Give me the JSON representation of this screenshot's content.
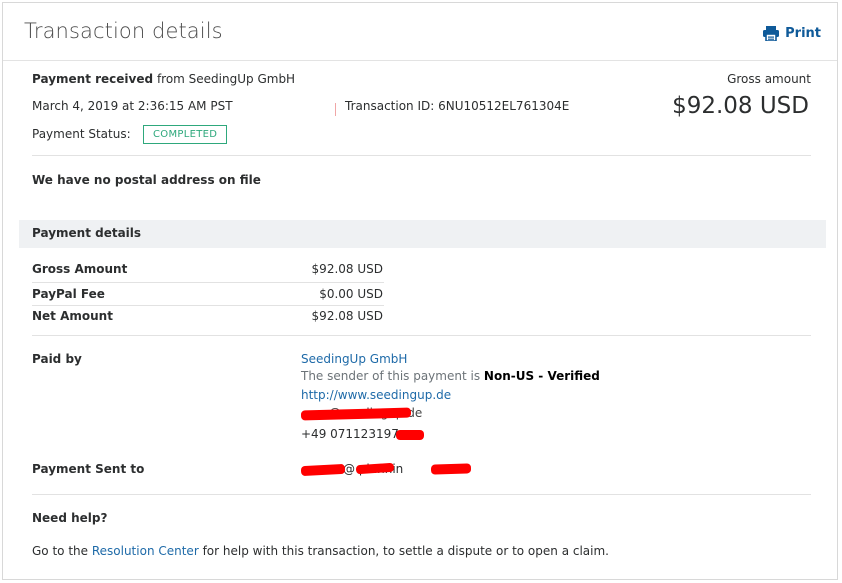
{
  "header": {
    "title": "Transaction details",
    "print_label": "Print"
  },
  "summary": {
    "payment_received_label": "Payment received",
    "from_text": "from SeedingUp GmbH",
    "date": "March 4, 2019 at 2:36:15 AM PST",
    "transaction_id": "Transaction ID: 6NU10512EL761304E",
    "status_label": "Payment Status:",
    "status_value": "COMPLETED",
    "gross_label": "Gross amount",
    "gross_value": "$92.08 USD",
    "address_note": "We have no postal address on file"
  },
  "payment_details": {
    "section_title": "Payment details",
    "rows": [
      {
        "label": "Gross Amount",
        "value": "$92.08 USD"
      },
      {
        "label": "PayPal Fee",
        "value": "$0.00 USD"
      },
      {
        "label": "Net Amount",
        "value": "$92.08 USD"
      }
    ]
  },
  "paid_by": {
    "label": "Paid by",
    "name": "SeedingUp GmbH",
    "sender_prefix": "The sender of this payment is",
    "sender_status": "Non-US - Verified",
    "website": "http://www.seedingup.de",
    "email_visible": "@seedingup.de",
    "phone": "+49 071123197"
  },
  "sent_to": {
    "label": "Payment Sent to",
    "email_visible": "@     plannin"
  },
  "help": {
    "title": "Need help?",
    "text_prefix": "Go to the",
    "link": "Resolution Center",
    "text_suffix": "for help with this transaction, to settle a dispute or to open a claim."
  },
  "colors": {
    "link": "#1e6aa8",
    "status_green": "#2ea87c",
    "print_blue": "#0f5a99",
    "redaction": "#ff0000"
  }
}
